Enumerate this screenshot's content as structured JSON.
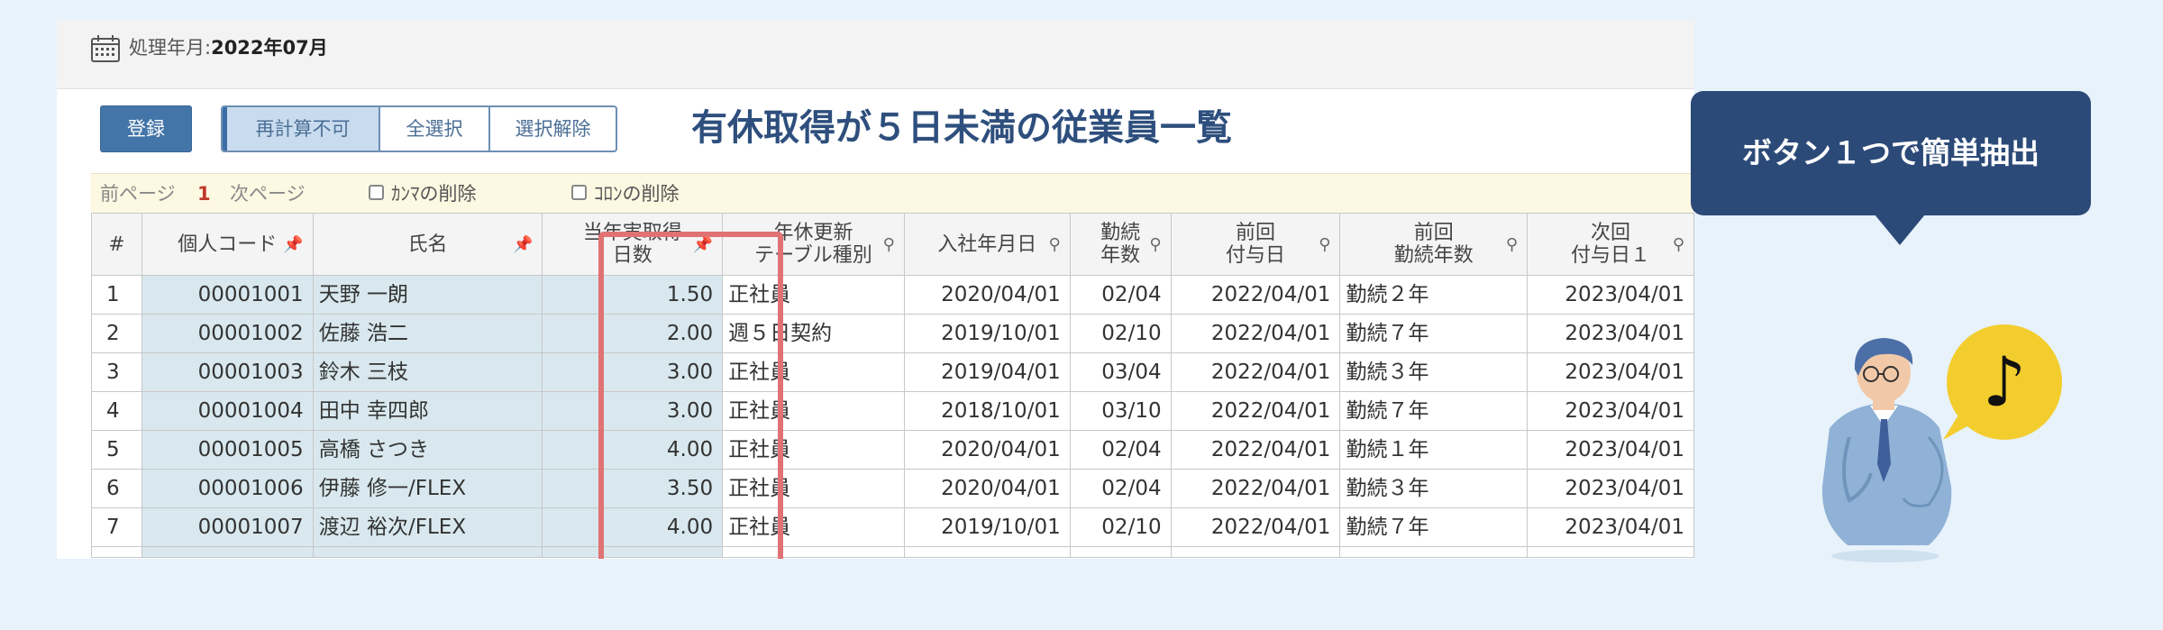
{
  "header": {
    "period_label": "処理年月:",
    "period_value": "2022年07月"
  },
  "toolbar": {
    "register": "登録",
    "recalc_disabled": "再計算不可",
    "select_all": "全選択",
    "deselect": "選択解除"
  },
  "headline": "有休取得が５日未満の従業員一覧",
  "pager": {
    "prev": "前ページ",
    "page": "1",
    "next": "次ページ",
    "remove_comma": "ｶﾝﾏの削除",
    "remove_colon": "ｺﾛﾝの削除"
  },
  "table": {
    "headers": {
      "index": "#",
      "code": "個人コード",
      "name": "氏名",
      "days_1": "当年実取得",
      "days_2": "日数",
      "table_type_1": "年休更新",
      "table_type_2": "テーブル種別",
      "hire_date": "入社年月日",
      "tenure_1": "勤続",
      "tenure_2": "年数",
      "last_grant_1": "前回",
      "last_grant_2": "付与日",
      "last_tenure_1": "前回",
      "last_tenure_2": "勤続年数",
      "next_grant_1": "次回",
      "next_grant_2": "付与日１"
    },
    "rows": [
      {
        "index": "1",
        "code": "00001001",
        "name": "天野 一朗",
        "days": "1.50",
        "table_type": "正社員",
        "hire_date": "2020/04/01",
        "tenure": "02/04",
        "last_grant": "2022/04/01",
        "last_tenure": "勤続２年",
        "next_grant": "2023/04/01"
      },
      {
        "index": "2",
        "code": "00001002",
        "name": "佐藤 浩二",
        "days": "2.00",
        "table_type": "週５日契約",
        "hire_date": "2019/10/01",
        "tenure": "02/10",
        "last_grant": "2022/04/01",
        "last_tenure": "勤続７年",
        "next_grant": "2023/04/01"
      },
      {
        "index": "3",
        "code": "00001003",
        "name": "鈴木 三枝",
        "days": "3.00",
        "table_type": "正社員",
        "hire_date": "2019/04/01",
        "tenure": "03/04",
        "last_grant": "2022/04/01",
        "last_tenure": "勤続３年",
        "next_grant": "2023/04/01"
      },
      {
        "index": "4",
        "code": "00001004",
        "name": "田中 幸四郎",
        "days": "3.00",
        "table_type": "正社員",
        "hire_date": "2018/10/01",
        "tenure": "03/10",
        "last_grant": "2022/04/01",
        "last_tenure": "勤続７年",
        "next_grant": "2023/04/01"
      },
      {
        "index": "5",
        "code": "00001005",
        "name": "高橋 さつき",
        "days": "4.00",
        "table_type": "正社員",
        "hire_date": "2020/04/01",
        "tenure": "02/04",
        "last_grant": "2022/04/01",
        "last_tenure": "勤続１年",
        "next_grant": "2023/04/01"
      },
      {
        "index": "6",
        "code": "00001006",
        "name": "伊藤 修一/FLEX",
        "days": "3.50",
        "table_type": "正社員",
        "hire_date": "2020/04/01",
        "tenure": "02/04",
        "last_grant": "2022/04/01",
        "last_tenure": "勤続３年",
        "next_grant": "2023/04/01"
      },
      {
        "index": "7",
        "code": "00001007",
        "name": "渡辺 裕次/FLEX",
        "days": "4.00",
        "table_type": "正社員",
        "hire_date": "2019/10/01",
        "tenure": "02/10",
        "last_grant": "2022/04/01",
        "last_tenure": "勤続７年",
        "next_grant": "2023/04/01"
      }
    ]
  },
  "callout": "ボタン１つで簡単抽出",
  "note_symbol": "♪",
  "icons": {
    "calendar": "calendar-icon",
    "pin": "pin-icon",
    "person": "person-illustration",
    "music_note": "music-note-icon"
  },
  "colors": {
    "primary": "#4475a8",
    "headline": "#2e4f7d",
    "highlight": "#e07274",
    "callout": "#2c4a78",
    "page_bg": "#e8f2fb"
  }
}
